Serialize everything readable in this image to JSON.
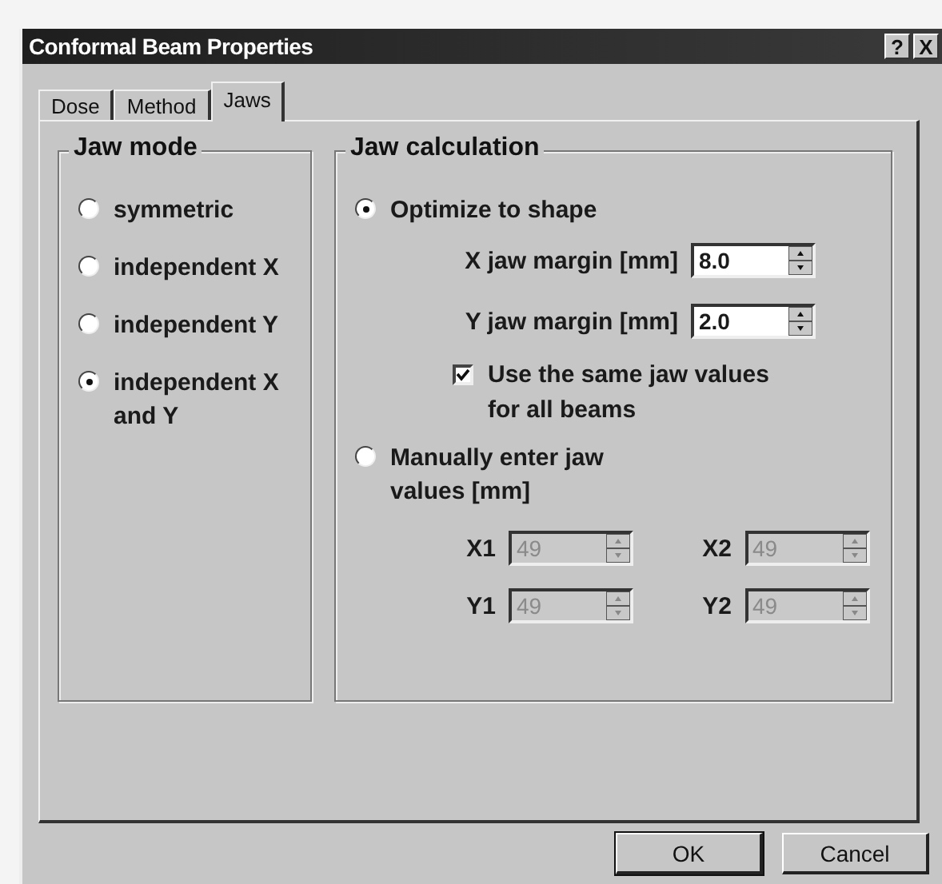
{
  "window": {
    "title": "Conformal Beam Properties",
    "help_button": "?",
    "close_button": "X"
  },
  "tabs": [
    {
      "label": "Dose",
      "selected": false
    },
    {
      "label": "Method",
      "selected": false
    },
    {
      "label": "Jaws",
      "selected": true
    }
  ],
  "jaw_mode": {
    "title": "Jaw mode",
    "options": [
      {
        "label": "symmetric",
        "selected": false
      },
      {
        "label": "independent X",
        "selected": false
      },
      {
        "label": "independent Y",
        "selected": false
      },
      {
        "label": "independent X and Y",
        "selected": true
      }
    ]
  },
  "jaw_calculation": {
    "title": "Jaw calculation",
    "optimize_option": {
      "label": "Optimize to shape",
      "selected": true
    },
    "margins": [
      {
        "label": "X jaw margin [mm]",
        "value": "8.0",
        "disabled": false
      },
      {
        "label": "Y jaw margin [mm]",
        "value": "2.0",
        "disabled": false
      }
    ],
    "same_values": {
      "label": "Use the same jaw values for all beams",
      "checked": true
    },
    "manual_option": {
      "label": "Manually enter jaw values [mm]",
      "selected": false
    },
    "manual_fields": [
      {
        "label": "X1",
        "value": "49",
        "disabled": true
      },
      {
        "label": "X2",
        "value": "49",
        "disabled": true
      },
      {
        "label": "Y1",
        "value": "49",
        "disabled": true
      },
      {
        "label": "Y2",
        "value": "49",
        "disabled": true
      }
    ]
  },
  "buttons": [
    {
      "label": "OK",
      "default": true
    },
    {
      "label": "Cancel",
      "default": false
    }
  ]
}
